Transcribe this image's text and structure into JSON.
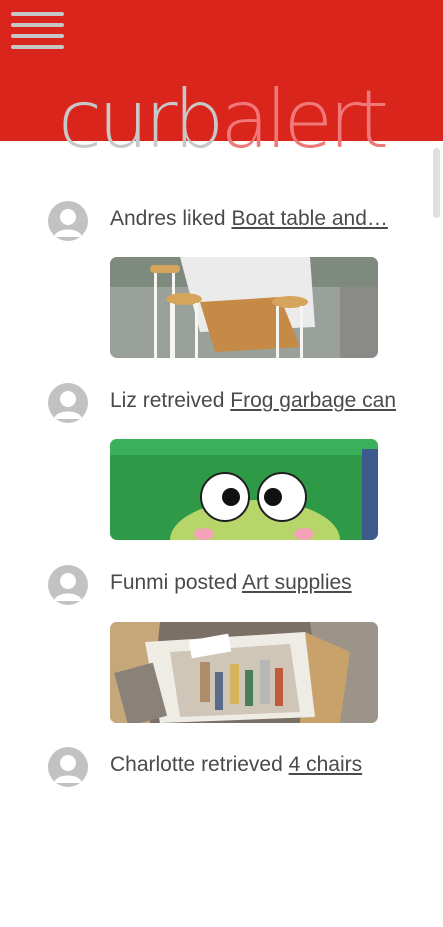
{
  "app": {
    "logo_part1": "curb",
    "logo_part2": "alert",
    "colors": {
      "header": "#d9251c",
      "logo_grey": "#c8c8c8",
      "logo_red": "#f07878"
    }
  },
  "feed": [
    {
      "user": "Andres",
      "action": "liked",
      "item": "Boat table and…",
      "image": "boat-table-photo"
    },
    {
      "user": "Liz",
      "action": "retreived",
      "item": "Frog garbage can",
      "image": "frog-garbage-can-photo"
    },
    {
      "user": "Funmi",
      "action": "posted",
      "item": "Art supplies",
      "image": "art-supplies-photo"
    },
    {
      "user": "Charlotte",
      "action": "retrieved",
      "item": "4 chairs",
      "image": "chairs-photo"
    }
  ]
}
